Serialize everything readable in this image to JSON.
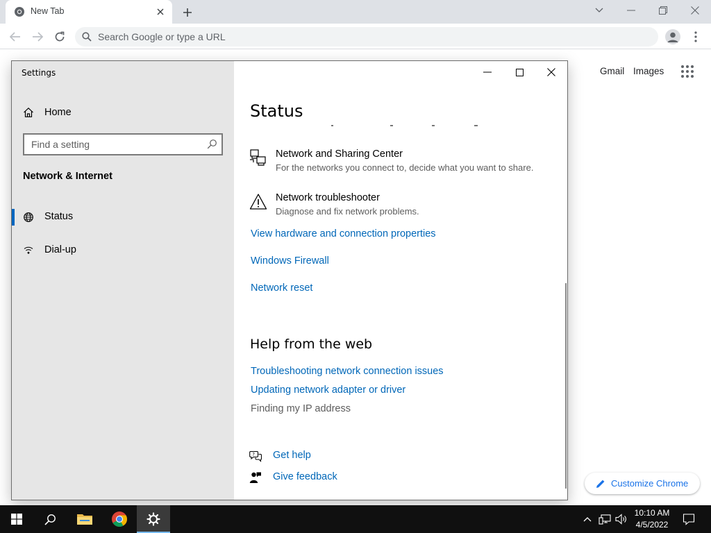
{
  "browser": {
    "tab_title": "New Tab",
    "omnibox_placeholder": "Search Google or type a URL",
    "ntp_links": [
      "Gmail",
      "Images"
    ],
    "customize_label": "Customize Chrome"
  },
  "settings": {
    "window_title": "Settings",
    "sidebar": {
      "home_label": "Home",
      "search_placeholder": "Find a setting",
      "section_title": "Network & Internet",
      "items": [
        {
          "label": "Status",
          "icon": "globe-icon",
          "active": true
        },
        {
          "label": "Dial-up",
          "icon": "dialup-icon",
          "active": false
        }
      ]
    },
    "main": {
      "page_title": "Status",
      "rows": [
        {
          "title": "Network and Sharing Center",
          "desc": "For the networks you connect to, decide what you want to share.",
          "icon": "network-sharing-icon"
        },
        {
          "title": "Network troubleshooter",
          "desc": "Diagnose and fix network problems.",
          "icon": "warning-icon"
        }
      ],
      "links": [
        "View hardware and connection properties",
        "Windows Firewall",
        "Network reset"
      ],
      "help_title": "Help from the web",
      "help_links": [
        "Troubleshooting network connection issues",
        "Updating network adapter or driver"
      ],
      "help_static": "Finding my IP address",
      "footer_links": [
        {
          "label": "Get help",
          "icon": "get-help-icon"
        },
        {
          "label": "Give feedback",
          "icon": "feedback-icon"
        }
      ]
    }
  },
  "taskbar": {
    "time": "10:10 AM",
    "date": "4/5/2022"
  }
}
